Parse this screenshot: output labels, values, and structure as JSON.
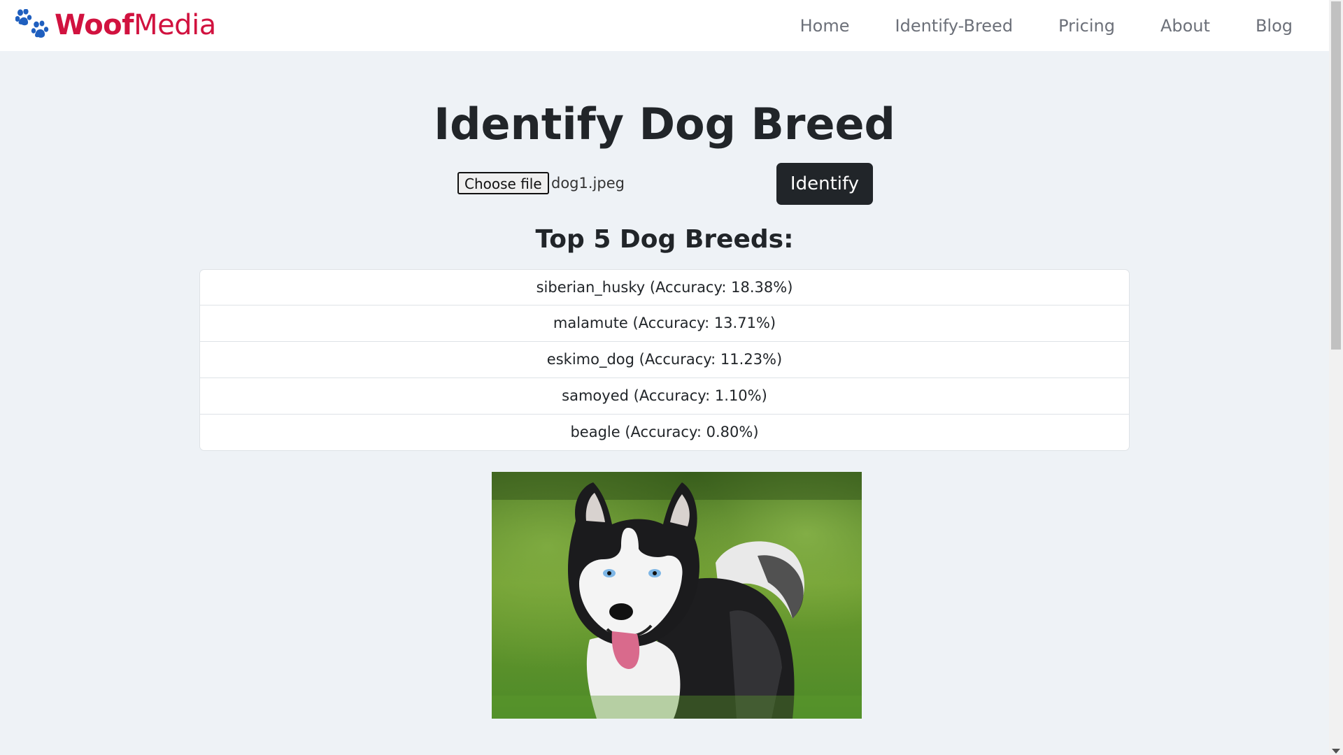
{
  "brand": {
    "part1": "Woof",
    "part2": "Media",
    "icon": "paw-icon"
  },
  "nav": {
    "items": [
      {
        "label": "Home"
      },
      {
        "label": "Identify-Breed"
      },
      {
        "label": "Pricing"
      },
      {
        "label": "About"
      },
      {
        "label": "Blog"
      }
    ]
  },
  "main": {
    "title": "Identify Dog Breed",
    "choose_file_label": "Choose file",
    "file_name": "dog1.jpeg",
    "identify_label": "Identify",
    "results_heading": "Top 5 Dog Breeds:",
    "results": [
      {
        "text": "siberian_husky (Accuracy: 18.38%)"
      },
      {
        "text": "malamute (Accuracy: 13.71%)"
      },
      {
        "text": "eskimo_dog (Accuracy: 11.23%)"
      },
      {
        "text": "samoyed (Accuracy: 1.10%)"
      },
      {
        "text": "beagle (Accuracy: 0.80%)"
      }
    ]
  },
  "colors": {
    "brand": "#d1123f",
    "paw": "#1f5fbf",
    "button": "#212529",
    "background": "#eef2f6"
  }
}
